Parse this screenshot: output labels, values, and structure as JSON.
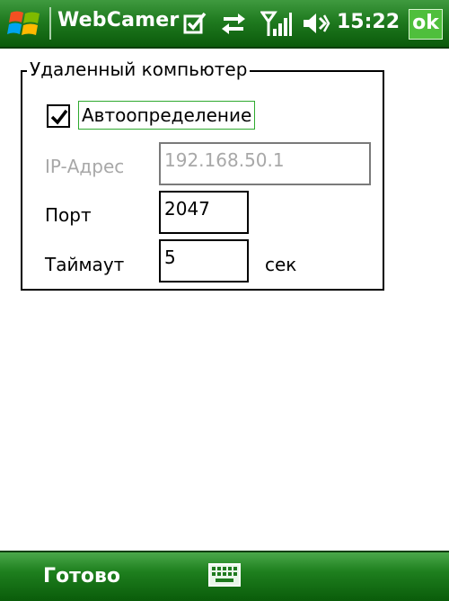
{
  "titlebar": {
    "app_title": "WebCamer",
    "clock": "15:22",
    "ok_label": "ok",
    "icons": [
      "windows-start-icon",
      "notes-checkbox-icon",
      "sync-arrows-icon",
      "signal-strength-icon",
      "volume-icon"
    ]
  },
  "group": {
    "legend": "Удаленный компьютер",
    "auto_checkbox": {
      "label": "Автоопределение",
      "checked": true
    },
    "ip": {
      "label": "IP-Адрес",
      "value": "192.168.50.1",
      "disabled": true
    },
    "port": {
      "label": "Порт",
      "value": "2047"
    },
    "timeout": {
      "label": "Таймаут",
      "value": "5",
      "unit": "сек"
    }
  },
  "softbar": {
    "left_label": "Готово",
    "center_icon": "keyboard-icon"
  },
  "colors": {
    "bar_green": "#1f7a1f",
    "ok_green": "#4fbf3c",
    "focus_green": "#2eaa2e",
    "disabled_gray": "#a8a8a8"
  }
}
